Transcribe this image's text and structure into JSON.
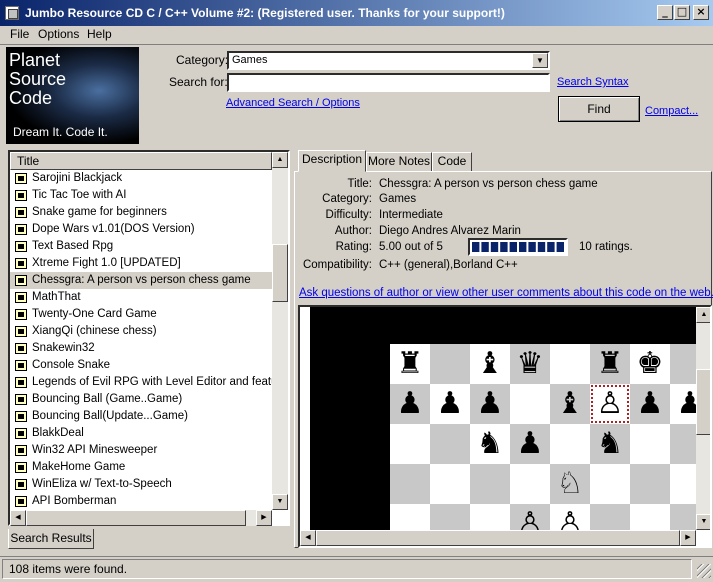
{
  "window": {
    "title": "Jumbo Resource CD C / C++ Volume #2: (Registered user.  Thanks for your support!)",
    "controls": {
      "minimize": "_",
      "maximize": "□",
      "close": "×"
    }
  },
  "menubar": {
    "items": [
      "File",
      "Options",
      "Help"
    ]
  },
  "logo": {
    "line1": "Planet",
    "line2": "Source",
    "line3": "Code",
    "tagline": "Dream It.  Code It."
  },
  "search": {
    "category_label": "Category:",
    "category_value": "Games",
    "searchfor_label": "Search for:",
    "searchfor_value": "",
    "syntax_link": "Search Syntax",
    "advanced_link": "Advanced Search / Options",
    "find_button": "Find",
    "compact_link": "Compact..."
  },
  "results": {
    "column_title": "Title",
    "items": [
      "Sarojini Blackjack",
      "Tic Tac Toe with AI",
      "Snake game for beginners",
      "Dope Wars v1.01(DOS Version)",
      "Text Based Rpg",
      "Xtreme Fight 1.0 [UPDATED]",
      "Chessgra: A person vs person chess game",
      "MathThat",
      "Twenty-One Card Game",
      "XiangQi (chinese chess)",
      "Snakewin32",
      "Console Snake",
      "Legends of Evil RPG with Level Editor and featurin",
      "Bouncing Ball (Game..Game)",
      "Bouncing Ball(Update...Game)",
      "BlakkDeal",
      "Win32 API Minesweeper",
      "MakeHome Game",
      "WinEliza w/ Text-to-Speech",
      "API Bomberman"
    ],
    "selected_index": 6,
    "bottom_tab": "Search Results"
  },
  "detail_tabs": [
    "Description",
    "More Notes",
    "Code"
  ],
  "detail": {
    "labels": [
      "Title:",
      "Category:",
      "Difficulty:",
      "Author:",
      "Rating:",
      "Compatibility:"
    ],
    "title": "Chessgra: A person vs person chess game",
    "category": "Games",
    "difficulty": "Intermediate",
    "author": "Diego Andres Alvarez Marin",
    "rating_text": "5.00 out of 5",
    "rating_fraction": 1.0,
    "rating_count": "10 ratings.",
    "compatibility": "C++ (general),Borland C++",
    "comments_link": "Ask questions of author or view other user comments about this code on the web..."
  },
  "status": {
    "text": "108 items were found."
  },
  "colors": {
    "titlebar_start": "#0a246a",
    "titlebar_end": "#a6caf0",
    "rating_fill": "#0a246a",
    "link": "#0000ee",
    "face": "#d4d0c8"
  }
}
